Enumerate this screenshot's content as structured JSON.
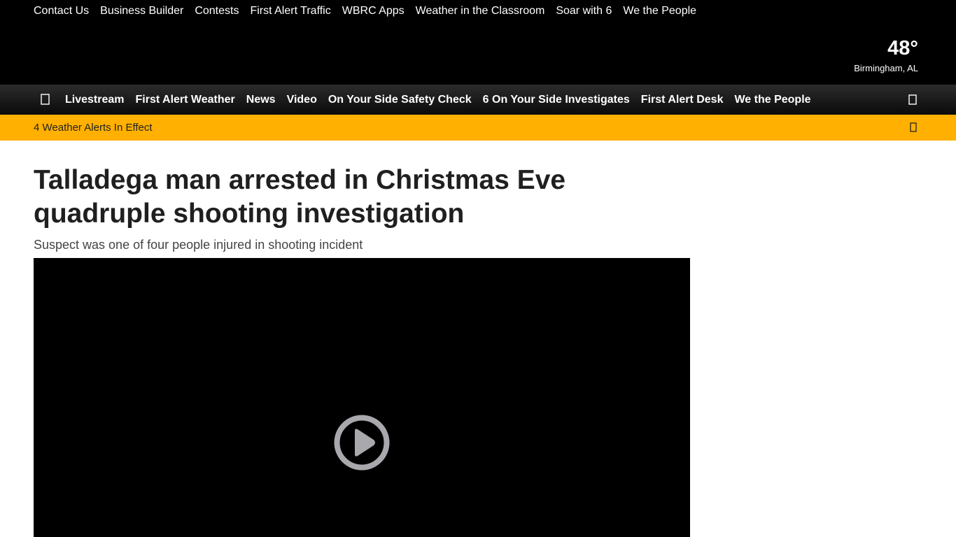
{
  "utility_nav": {
    "links": [
      "Contact Us",
      "Business Builder",
      "Contests",
      "First Alert Traffic",
      "WBRC Apps",
      "Weather in the Classroom",
      "Soar with 6",
      "We the People"
    ]
  },
  "weather": {
    "temperature": "48°",
    "location": "Birmingham, AL"
  },
  "main_nav": {
    "menu_icon": "hamburger-menu-icon",
    "search_icon": "search-icon",
    "items": [
      "Livestream",
      "First Alert Weather",
      "News",
      "Video",
      "On Your Side Safety Check",
      "6 On Your Side Investigates",
      "First Alert Desk",
      "We the People"
    ]
  },
  "alert_bar": {
    "text": "4 Weather Alerts In Effect",
    "icon": "chevron-down-icon",
    "color": "#ffb000"
  },
  "article": {
    "headline": "Talladega man arrested in Christmas Eve quadruple shooting investigation",
    "subheadline": "Suspect was one of four people injured in shooting incident",
    "video": {
      "play_icon": "play-icon"
    }
  }
}
